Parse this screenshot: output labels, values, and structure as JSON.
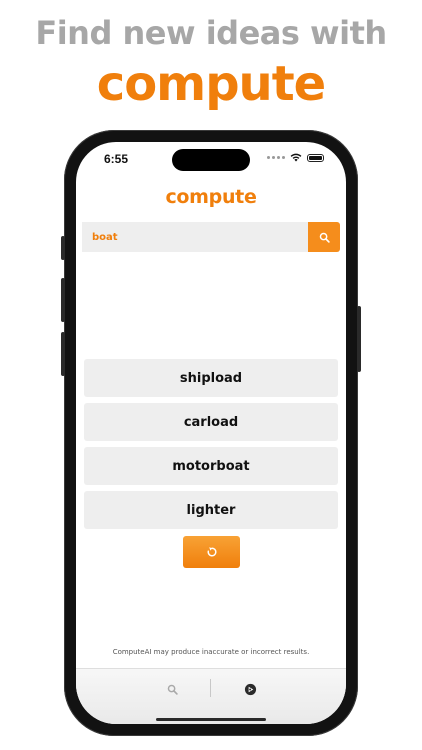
{
  "promo": {
    "line1": "Find new ideas with",
    "line2": "compute"
  },
  "status_bar": {
    "time": "6:55"
  },
  "app": {
    "logo": "compute"
  },
  "search": {
    "value": "boat",
    "icon": "search-icon"
  },
  "results": [
    {
      "label": "shipload"
    },
    {
      "label": "carload"
    },
    {
      "label": "motorboat"
    },
    {
      "label": "lighter"
    }
  ],
  "refresh_icon": "refresh-icon",
  "disclaimer": "ComputeAI may produce inaccurate or incorrect results.",
  "tabbar": {
    "tabs": [
      {
        "icon": "search-icon"
      },
      {
        "icon": "compass-icon"
      }
    ]
  },
  "colors": {
    "accent": "#f07f0c",
    "accent_light": "#f58d1c",
    "promo_gray": "#a7a7a7",
    "field_bg": "#eeeeee"
  }
}
